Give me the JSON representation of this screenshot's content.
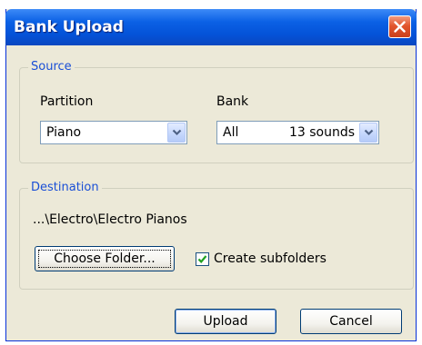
{
  "window": {
    "title": "Bank Upload"
  },
  "source": {
    "legend": "Source",
    "partition_label": "Partition",
    "partition_value": "Piano",
    "bank_label": "Bank",
    "bank_value": "All",
    "bank_count": "13 sounds"
  },
  "destination": {
    "legend": "Destination",
    "path": "...\\Electro\\Electro Pianos",
    "choose_folder_label": "Choose Folder...",
    "create_subfolders_label": "Create subfolders",
    "create_subfolders_checked": true
  },
  "buttons": {
    "upload": "Upload",
    "cancel": "Cancel"
  },
  "colors": {
    "titlebar": "#0453d8",
    "legend_text": "#1a4fd6",
    "dialog_bg": "#ece9d8",
    "close": "#e2552d"
  },
  "icons": {
    "close": "close-icon",
    "dropdown": "chevron-down-icon",
    "check": "checkmark-icon"
  }
}
